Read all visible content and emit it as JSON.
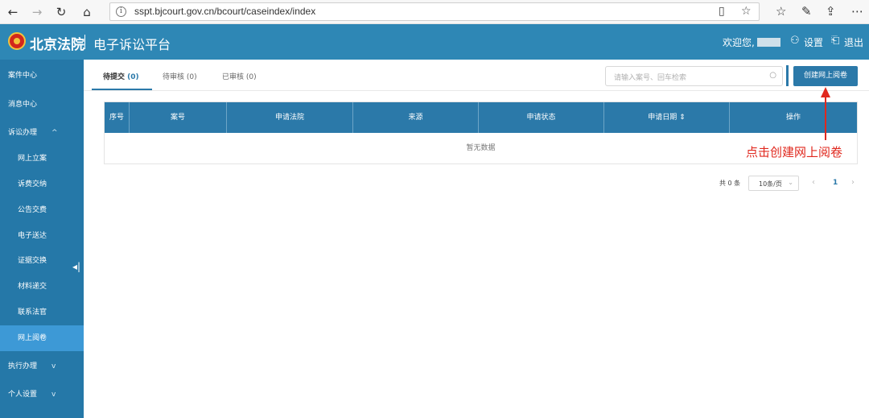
{
  "browser": {
    "url": "sspt.bjcourt.gov.cn/bcourt/caseindex/index"
  },
  "header": {
    "court_name": "北京法院",
    "platform_name": "电子诉讼平台",
    "welcome": "欢迎您,",
    "settings_label": "设置",
    "logout_label": "退出"
  },
  "sidebar": {
    "items": [
      {
        "label": "案件中心"
      },
      {
        "label": "消息中心"
      },
      {
        "label": "诉讼办理",
        "chevron": "^"
      },
      {
        "label": "网上立案"
      },
      {
        "label": "诉费交纳"
      },
      {
        "label": "公告交费"
      },
      {
        "label": "电子送达"
      },
      {
        "label": "证据交换"
      },
      {
        "label": "材料递交"
      },
      {
        "label": "联系法官"
      },
      {
        "label": "网上阅卷"
      },
      {
        "label": "执行办理",
        "chevron": "v"
      },
      {
        "label": "个人设置",
        "chevron": "v"
      }
    ],
    "active_item": "网上阅卷"
  },
  "tabs": [
    {
      "label": "待提交",
      "count": "(0)"
    },
    {
      "label": "待审核",
      "count": "(0)"
    },
    {
      "label": "已审核",
      "count": "(0)"
    }
  ],
  "search": {
    "placeholder": "请输入案号、回车检索"
  },
  "create_button": "创建网上阅卷",
  "table": {
    "columns": [
      "序号",
      "案号",
      "申请法院",
      "来源",
      "申请状态",
      "申请日期",
      "操作"
    ],
    "sort_indicator": "⇕",
    "empty_text": "暂无数据"
  },
  "pagination": {
    "total": "共 0 条",
    "page_size": "10条/页",
    "current_page": "1"
  },
  "annotation": "点击创建网上阅卷",
  "colors": {
    "header_bg": "#2e87b5",
    "sidebar_bg": "#2578a8",
    "sidebar_active": "#3d99d6",
    "primary": "#2b79a9",
    "annotation": "#e0281e"
  }
}
